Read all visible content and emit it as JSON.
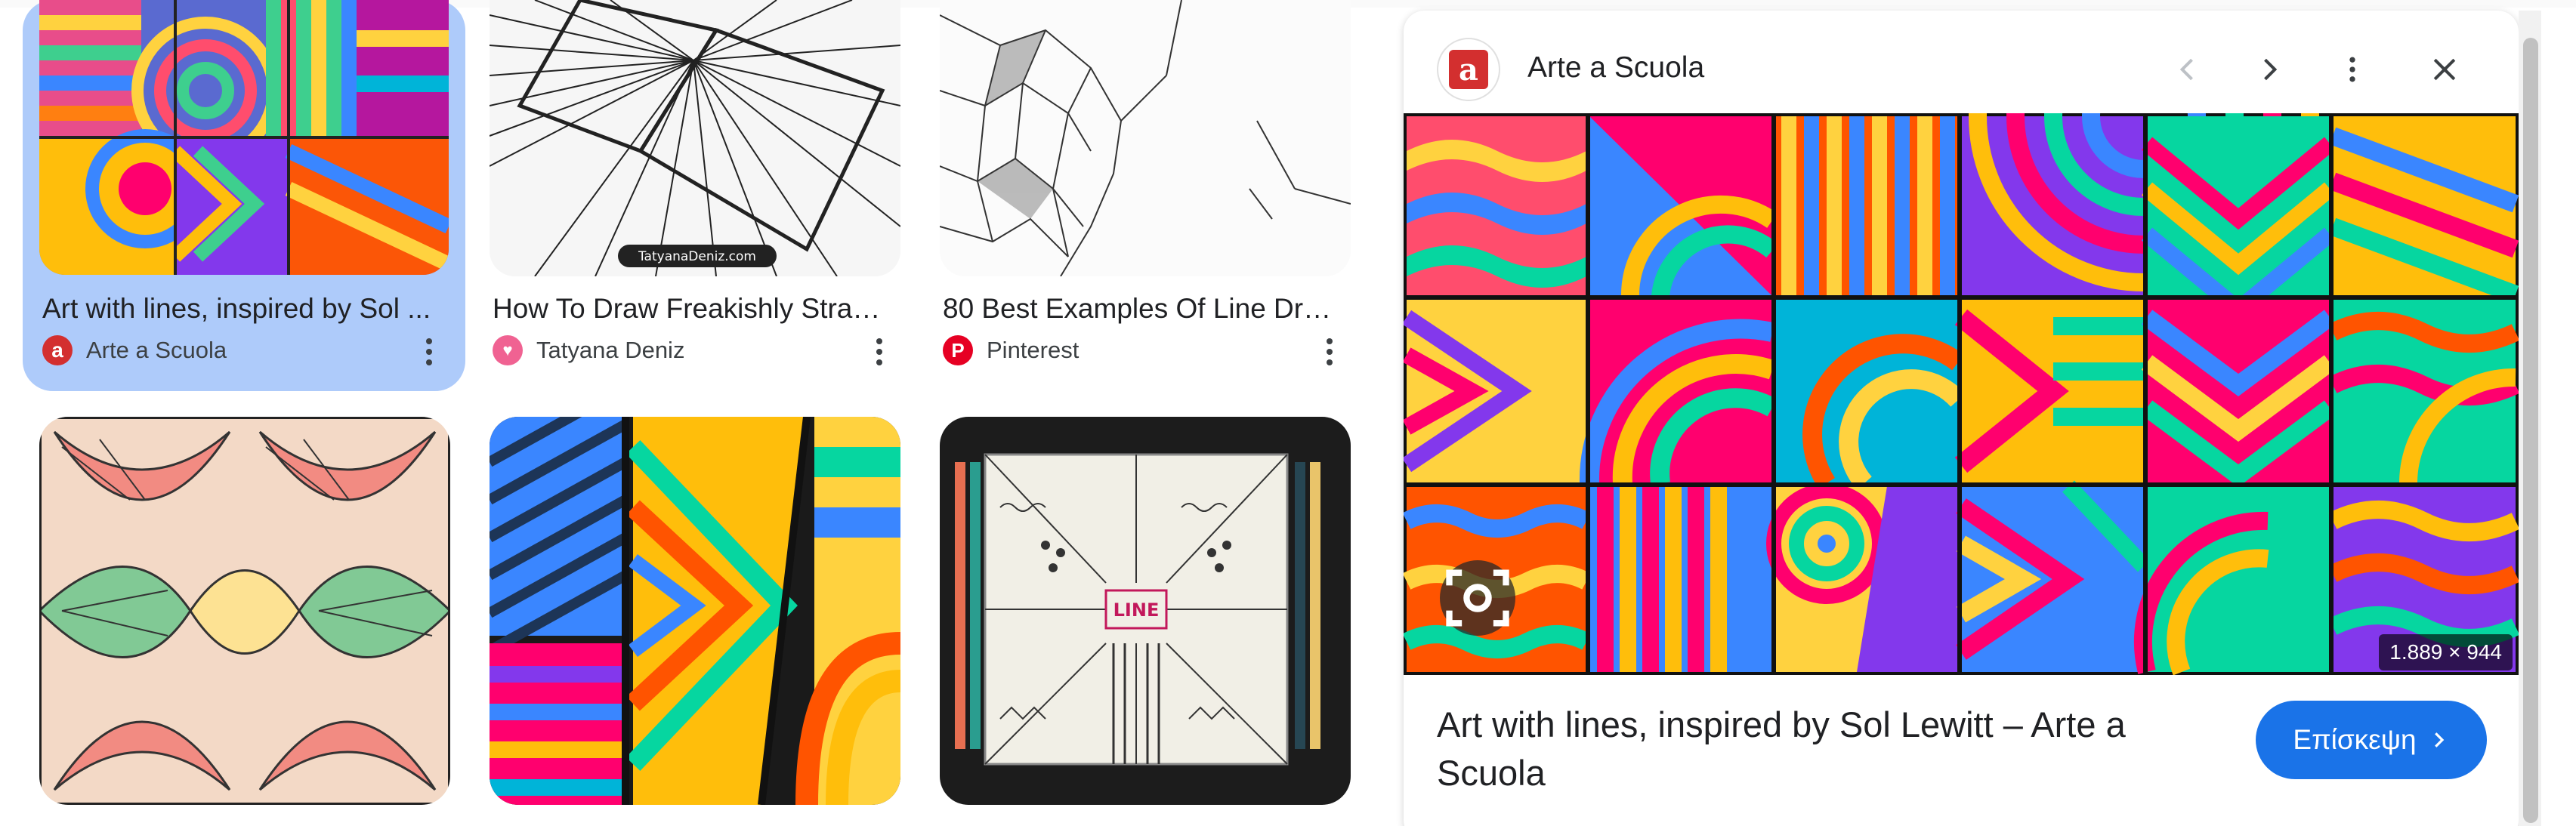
{
  "results": [
    {
      "title": "Art with lines, inspired by Sol ...",
      "source": "Arte a Scuola",
      "favicon": "arte-a-scuola-icon",
      "selected": true
    },
    {
      "title": "How To Draw Freakishly Straig...",
      "source": "Tatyana Deniz",
      "favicon": "heart-icon",
      "selected": false
    },
    {
      "title": "80 Best Examples Of Line Dra...",
      "source": "Pinterest",
      "favicon": "pinterest-icon",
      "selected": false
    },
    {
      "title": "",
      "source": "",
      "favicon": "",
      "selected": false
    },
    {
      "title": "",
      "source": "",
      "favicon": "",
      "selected": false
    },
    {
      "title": "",
      "source": "",
      "favicon": "",
      "selected": false
    }
  ],
  "thumbnail_caption": "TatyanaDeniz.com",
  "doodle_label": "LINE",
  "preview": {
    "site_name": "Arte a Scuola",
    "dimensions": "1.889 × 944",
    "title": "Art with lines, inspired by Sol Lewitt – Arte a Scuola",
    "visit_label": "Επίσκεψη",
    "icons": {
      "logo": "arte-a-scuola-logo",
      "prev": "chevron-left-icon",
      "next": "chevron-right-icon",
      "more": "more-vert-icon",
      "close": "close-icon",
      "lens": "lens-search-icon"
    }
  },
  "colors": {
    "selected_card": "#aecbfa",
    "visit_button": "#1a73e8",
    "logo_red": "#d32f2f",
    "pinterest_red": "#e60023",
    "heart_pink": "#f06292"
  }
}
